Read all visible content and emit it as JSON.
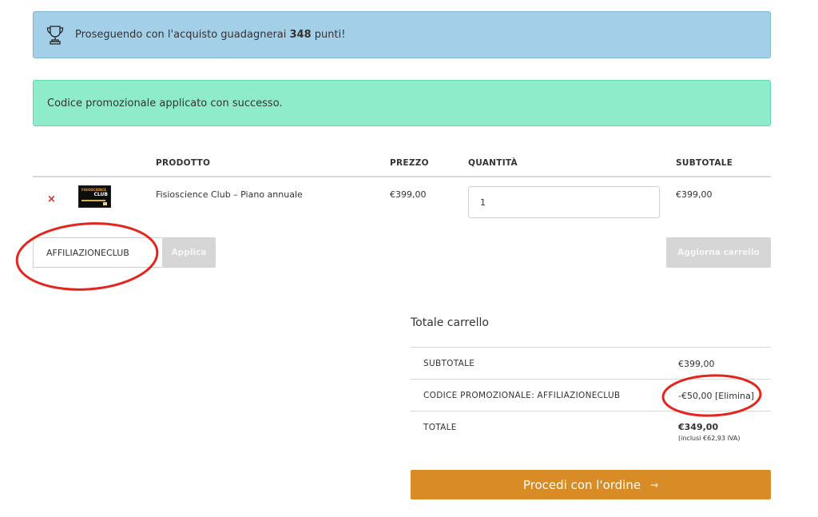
{
  "points_notice": {
    "text_before": "Proseguendo con l'acquisto guadagnerai ",
    "points": "348",
    "text_after": " punti!"
  },
  "success_notice": {
    "text": "Codice promozionale applicato con successo."
  },
  "cart": {
    "headers": {
      "product": "PRODOTTO",
      "price": "PREZZO",
      "quantity": "QUANTITÀ",
      "subtotal": "SUBTOTALE"
    },
    "items": [
      {
        "remove": "×",
        "thumb_text_top": "FISIOSCIENCE",
        "thumb_text_main": "CLUB",
        "name": "Fisioscience Club – Piano annuale",
        "price": "€399,00",
        "quantity": "1",
        "subtotal": "€399,00"
      }
    ]
  },
  "coupon": {
    "value": "AFFILIAZIONECLUB",
    "apply_label": "Applica"
  },
  "update_cart_label": "Aggiorna carrello",
  "totals": {
    "title": "Totale carrello",
    "subtotal_label": "SUBTOTALE",
    "subtotal_value": "€399,00",
    "coupon_label": "CODICE PROMOZIONALE: AFFILIAZIONECLUB",
    "coupon_value": "-€50,00",
    "coupon_remove": "[Elimina]",
    "total_label": "TOTALE",
    "total_value": "€349,00",
    "total_tax": "(inclusi €62,93 IVA)"
  },
  "checkout": {
    "label": "Procedi con l'ordine",
    "arrow": "→"
  },
  "colors": {
    "info_bg": "#a3cfe8",
    "success_bg": "#8feccb",
    "checkout_bg": "#d98b26",
    "remove_red": "#e2231a",
    "annotation_red": "#e3251d"
  }
}
